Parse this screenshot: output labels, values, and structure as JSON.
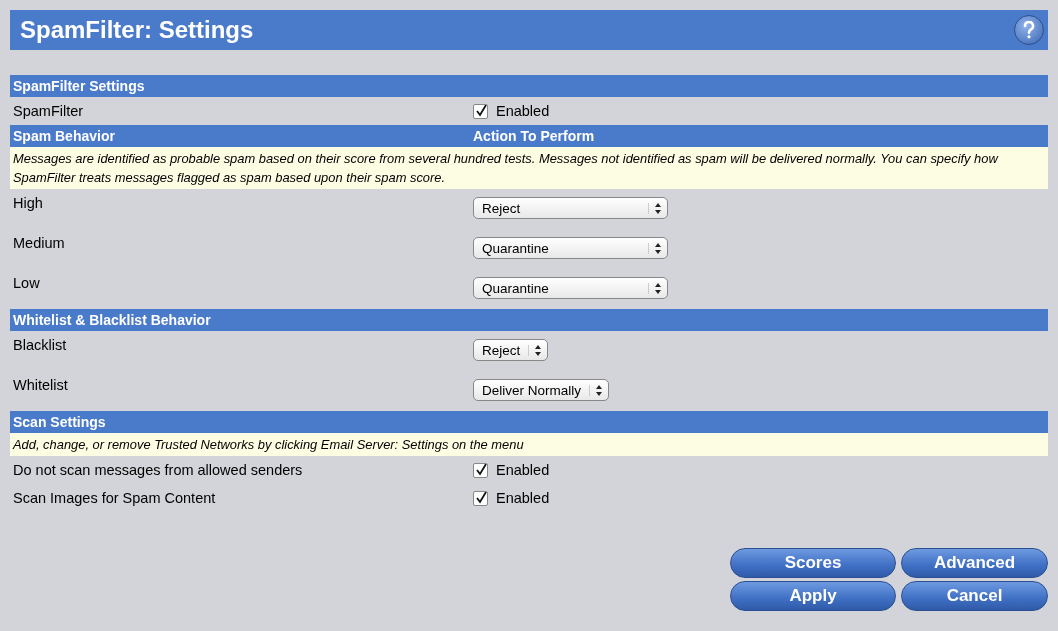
{
  "title": "SpamFilter: Settings",
  "sections": [
    {
      "header": "SpamFilter Settings",
      "rows": [
        {
          "kind": "checkbox",
          "label": "SpamFilter",
          "checked": true,
          "text": "Enabled"
        }
      ]
    },
    {
      "header": "Spam Behavior",
      "header_right": "Action To Perform",
      "note": "Messages are identified as probable spam based on their score from several hundred tests. Messages not identified as spam will be delivered normally. You can specify how SpamFilter treats messages flagged as spam based upon their spam score.",
      "rows": [
        {
          "kind": "select",
          "label": "High",
          "value": "Reject"
        },
        {
          "kind": "select",
          "label": "Medium",
          "value": "Quarantine"
        },
        {
          "kind": "select",
          "label": "Low",
          "value": "Quarantine"
        }
      ]
    },
    {
      "header": "Whitelist & Blacklist Behavior",
      "rows": [
        {
          "kind": "select",
          "label": "Blacklist",
          "value": "Reject"
        },
        {
          "kind": "select",
          "label": "Whitelist",
          "value": "Deliver Normally"
        }
      ]
    },
    {
      "header": "Scan Settings",
      "note": "Add, change, or remove Trusted Networks by clicking Email Server: Settings on the menu",
      "rows": [
        {
          "kind": "checkbox",
          "label": "Do not scan messages from allowed senders",
          "checked": true,
          "text": "Enabled"
        },
        {
          "kind": "checkbox",
          "label": "Scan Images for Spam Content",
          "checked": true,
          "text": "Enabled"
        }
      ]
    }
  ],
  "buttons": [
    "Scores",
    "Advanced",
    "Apply",
    "Cancel"
  ]
}
